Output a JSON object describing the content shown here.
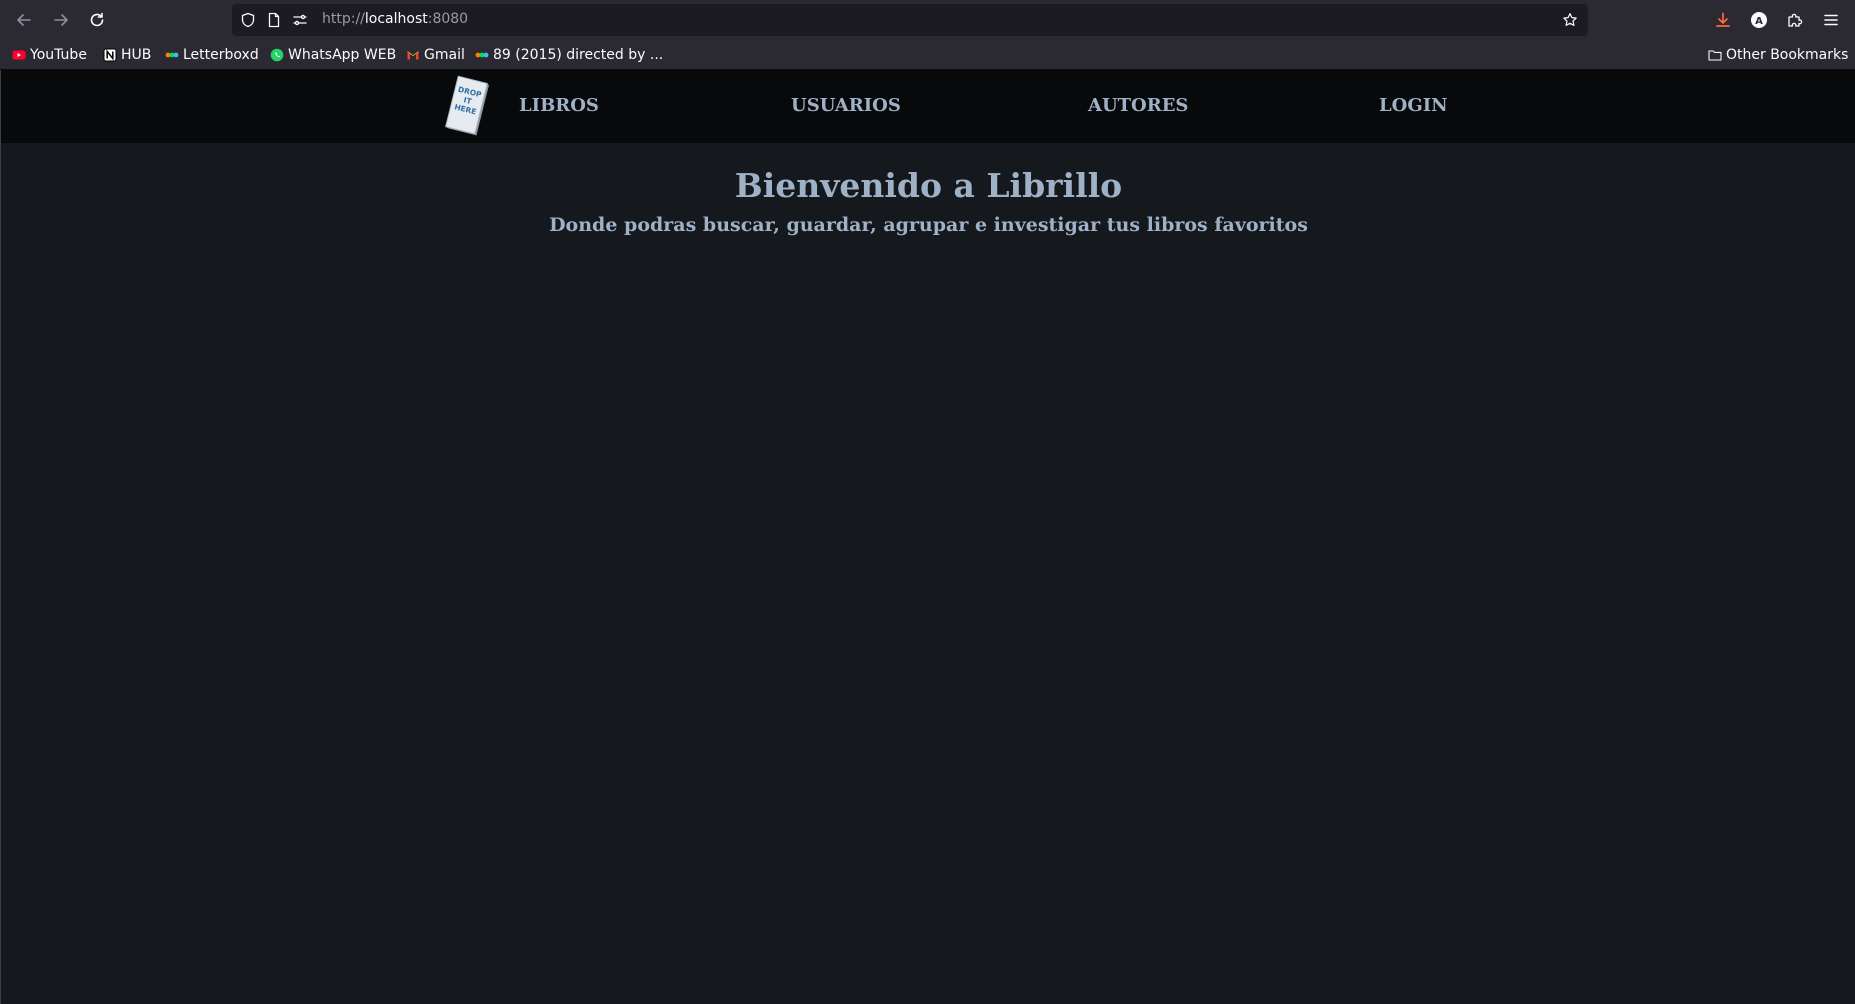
{
  "browser": {
    "url_scheme": "http://",
    "url_host": "localhost",
    "url_port": ":8080",
    "profile_initial": "A",
    "icons": {
      "back": "arrow-left-icon",
      "forward": "arrow-right-icon",
      "reload": "reload-icon",
      "shield": "shield-icon",
      "page": "page-icon",
      "permissions": "permissions-icon",
      "bookmark_star": "star-icon",
      "downloads": "download-icon",
      "account": "account-icon",
      "extensions": "puzzle-icon",
      "menu": "hamburger-menu-icon"
    },
    "colors": {
      "toolbar_bg": "#2b2a33",
      "urlbar_bg": "#1c1b22",
      "download_accent": "#ff6a3d"
    }
  },
  "bookmarks": {
    "items": [
      {
        "label": "YouTube",
        "icon": "youtube-icon"
      },
      {
        "label": "HUB",
        "icon": "notion-icon"
      },
      {
        "label": "Letterboxd",
        "icon": "letterboxd-icon"
      },
      {
        "label": "WhatsApp WEB",
        "icon": "whatsapp-icon"
      },
      {
        "label": "Gmail",
        "icon": "gmail-icon"
      },
      {
        "label": "89 (2015) directed by ...",
        "icon": "letterboxd-icon"
      }
    ],
    "other": {
      "label": "Other Bookmarks",
      "icon": "folder-icon"
    }
  },
  "site": {
    "logo_text": [
      "DROP",
      "IT",
      "HERE"
    ],
    "nav": {
      "libros": "LIBROS",
      "usuarios": "USUARIOS",
      "autores": "AUTORES",
      "login": "LOGIN"
    },
    "hero": {
      "title": "Bienvenido a Librillo",
      "subtitle": "Donde podras buscar, guardar, agrupar e investigar tus libros favoritos"
    },
    "colors": {
      "page_bg": "#15181d",
      "nav_bg": "#08090b",
      "text": "#9fb1c6"
    }
  }
}
